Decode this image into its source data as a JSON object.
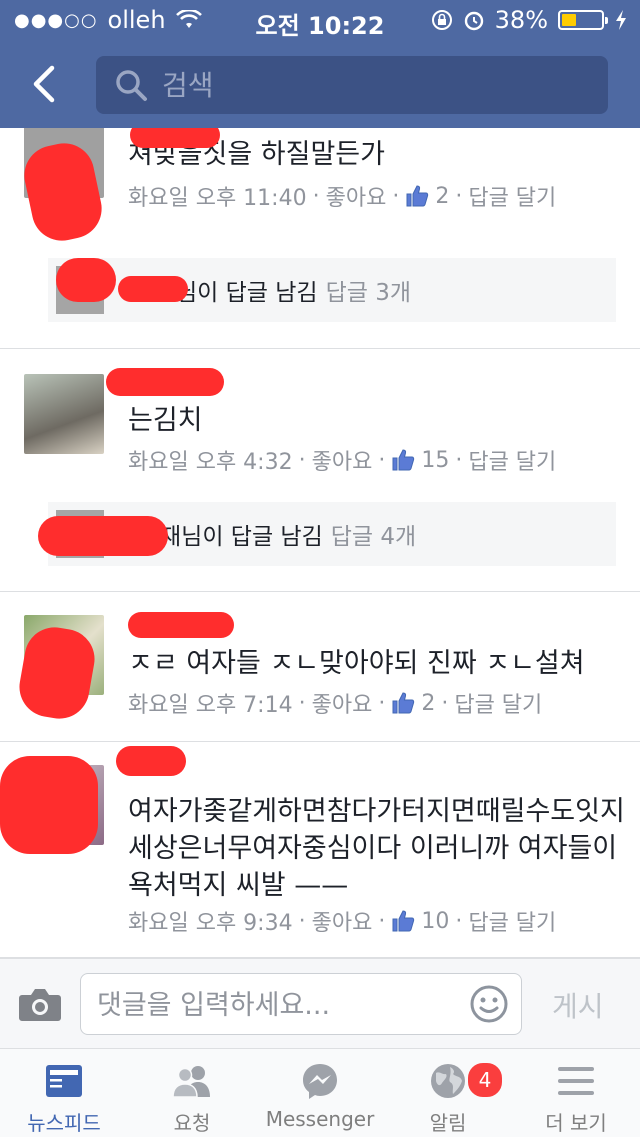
{
  "status_bar": {
    "signal": "●●●○○",
    "carrier": "olleh",
    "time": "오전 10:22",
    "battery": "38%",
    "battery_level": 0.38
  },
  "header": {
    "search_placeholder": "검색"
  },
  "comments": [
    {
      "text": "쳐맞을짓을 하질말든가",
      "time": "화요일 오후 11:40",
      "like_label": "좋아요",
      "like_count": "2",
      "reply_label": "답글 달기",
      "reply_summary": "님이 답글 남김",
      "reply_count": "답글 3개"
    },
    {
      "text": "는김치",
      "time": "화요일 오후 4:32",
      "like_label": "좋아요",
      "like_count": "15",
      "reply_label": "답글 달기",
      "reply_summary": "재님이 답글 남김",
      "reply_count": "답글 4개"
    },
    {
      "text": "ㅈㄹ 여자들 ㅈㄴ맞아야되 진짜 ㅈㄴ설쳐",
      "time": "화요일 오후 7:14",
      "like_label": "좋아요",
      "like_count": "2",
      "reply_label": "답글 달기"
    },
    {
      "text": "여자가좆같게하면참다가터지면때릴수도잇지\n세상은너무여자중심이다 이러니까 여자들이\n욕처먹지 씨발 ——",
      "time": "화요일 오후 9:34",
      "like_label": "좋아요",
      "like_count": "10",
      "reply_label": "답글 달기"
    }
  ],
  "composer": {
    "placeholder": "댓글을 입력하세요...",
    "post_label": "게시"
  },
  "tabs": [
    {
      "label": "뉴스피드",
      "icon": "news-feed-icon"
    },
    {
      "label": "요청",
      "icon": "friend-requests-icon"
    },
    {
      "label": "Messenger",
      "icon": "messenger-icon"
    },
    {
      "label": "알림",
      "icon": "globe-icon",
      "badge": "4"
    },
    {
      "label": "더 보기",
      "icon": "menu-icon"
    }
  ],
  "colors": {
    "header": "#4e69a2",
    "link": "#365899",
    "meta": "#90949c",
    "active_tab": "#4267b2",
    "badge": "#fa3e3e",
    "redaction": "#ff2d2d"
  }
}
